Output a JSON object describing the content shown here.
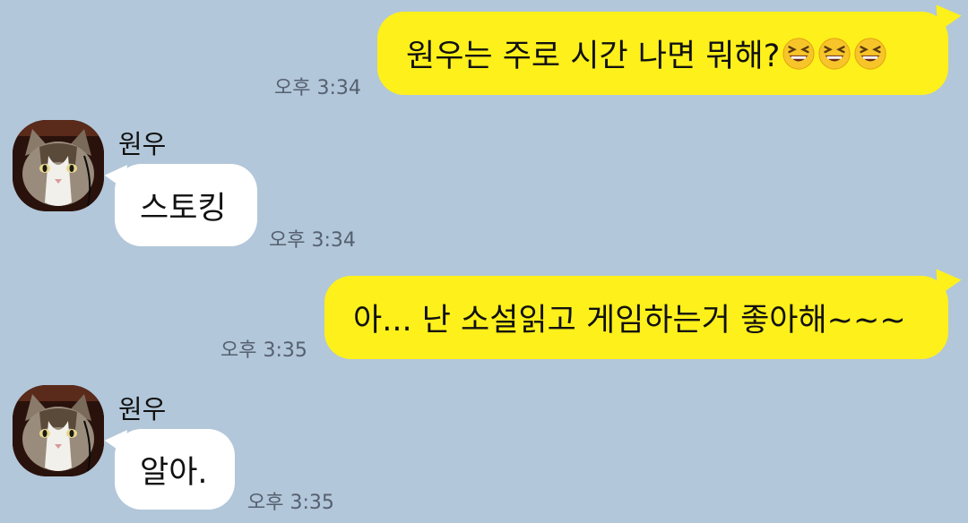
{
  "chat": {
    "messages": [
      {
        "sender": "me",
        "text": "원우는 주로 시간 나면 뭐해?",
        "emoji": [
          "laughing-face",
          "laughing-face",
          "laughing-face"
        ],
        "time": "오후 3:34"
      },
      {
        "sender": "other",
        "name": "원우",
        "text": "스토킹",
        "time": "오후 3:34"
      },
      {
        "sender": "me",
        "text": "아... 난 소설읽고 게임하는거 좋아해~~~",
        "time": "오후 3:35"
      },
      {
        "sender": "other",
        "name": "원우",
        "text": "알아.",
        "time": "오후 3:35"
      }
    ]
  },
  "colors": {
    "background": "#b2c7d9",
    "my_bubble": "#fef01b",
    "other_bubble": "#ffffff",
    "time_text": "#556070"
  }
}
